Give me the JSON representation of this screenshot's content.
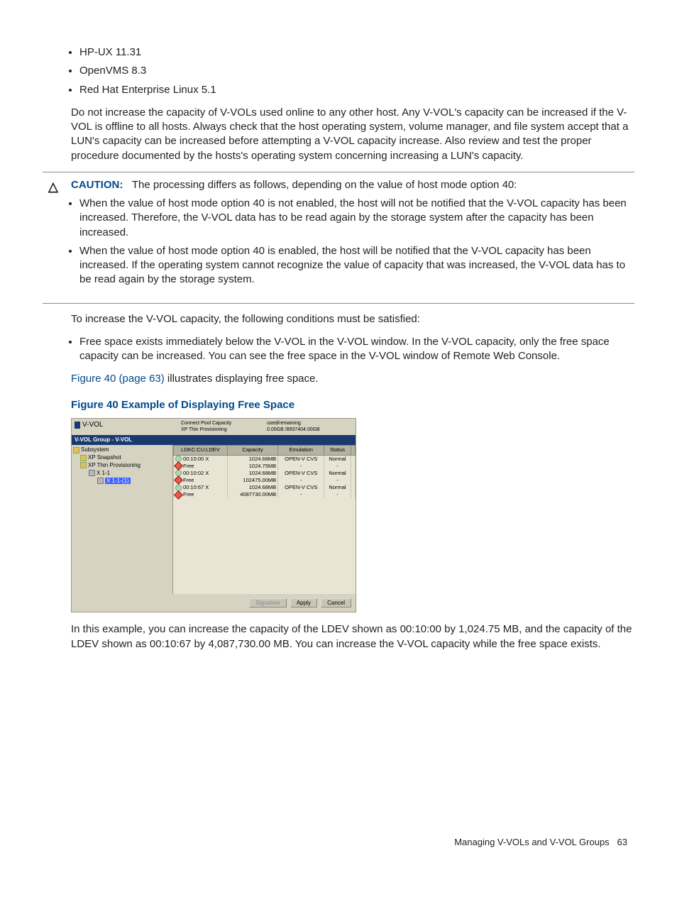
{
  "intro_list": [
    "HP-UX 11.31",
    "OpenVMS 8.3",
    "Red Hat Enterprise Linux 5.1"
  ],
  "para1": "Do not increase the capacity of V-VOLs used online to any other host. Any V-VOL's capacity can be increased if the V-VOL is offline to all hosts. Always check that the host operating system, volume manager, and file system accept that a LUN's capacity can be increased before attempting a V-VOL capacity increase. Also review and test the proper procedure documented by the hosts's operating system concerning increasing a LUN's capacity.",
  "caution": {
    "label": "CAUTION:",
    "lead": "The processing differs as follows, depending on the value of host mode option 40:",
    "items": [
      "When the value of host mode option 40 is not enabled, the host will not be notified that the V-VOL capacity has been increased. Therefore, the V-VOL data has to be read again by the storage system after the capacity has been increased.",
      "When the value of host mode option 40 is enabled, the host will be notified that the V-VOL capacity has been increased. If the operating system cannot recognize the value of capacity that was increased, the V-VOL data has to be read again by the storage system."
    ]
  },
  "para2": "To increase the V-VOL capacity, the following conditions must be satisfied:",
  "cond_list": [
    "Free space exists immediately below the V-VOL in the V-VOL window. In the V-VOL capacity, only the free space capacity can be increased. You can see the free space in the V-VOL window of Remote Web Console."
  ],
  "figref_link": "Figure 40 (page 63)",
  "figref_rest": " illustrates displaying free space.",
  "fig_title": "Figure 40 Example of Displaying Free Space",
  "shot": {
    "vvol": "V-VOL",
    "metric_lbl_1": "Connect Pool Capacity",
    "metric_lbl_2": "XP Thin Provisioning",
    "metric_lbl_3": "used/remaining",
    "metric_lbl_4": "0.00GB /8937404.00GB",
    "group_bar": "V-VOL Group - V-VOL",
    "tree": {
      "n0": "Subsystem",
      "n1": "XP Snapshot",
      "n2": "XP Thin Provisioning",
      "n3": "X 1-1",
      "n4": "X 1-1-(1)"
    },
    "headers": [
      "LDKC:CU:LDEV",
      "Capacity",
      "Emulation",
      "Status",
      ""
    ],
    "rows": [
      {
        "ico": "disk",
        "c0": "00:10:00 X",
        "c1": "1024.68MB",
        "c2": "OPEN-V CVS",
        "c3": "Normal",
        "c4": ""
      },
      {
        "ico": "star",
        "c0": "Free",
        "c1": "1024.75MB",
        "c2": "-",
        "c3": "-",
        "c4": ""
      },
      {
        "ico": "disk",
        "c0": "00:10:02 X",
        "c1": "1024.68MB",
        "c2": "OPEN-V CVS",
        "c3": "Normal",
        "c4": ""
      },
      {
        "ico": "star",
        "c0": "Free",
        "c1": "102475.00MB",
        "c2": "-",
        "c3": "-",
        "c4": ""
      },
      {
        "ico": "disk",
        "c0": "00:10:67 X",
        "c1": "1024.68MB",
        "c2": "OPEN-V CVS",
        "c3": "Normal",
        "c4": ""
      },
      {
        "ico": "star",
        "c0": "Free",
        "c1": "4087730.00MB",
        "c2": "-",
        "c3": "-",
        "c4": ""
      }
    ],
    "buttons": {
      "b1": "Signature",
      "b2": "Apply",
      "b3": "Cancel"
    }
  },
  "para3": "In this example, you can increase the capacity of the LDEV shown as 00:10:00 by 1,024.75 MB, and the capacity of the LDEV shown as 00:10:67 by 4,087,730.00 MB. You can increase the V-VOL capacity while the free space exists.",
  "footer": {
    "title": "Managing V-VOLs and V-VOL Groups",
    "page": "63"
  }
}
